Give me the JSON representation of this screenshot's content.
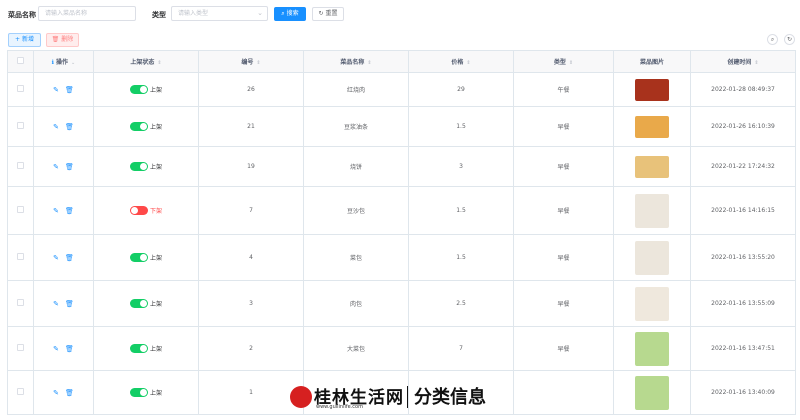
{
  "search": {
    "name_label": "菜品名称",
    "name_placeholder": "请输入菜品名称",
    "type_label": "类型",
    "type_placeholder": "请输入类型",
    "search_button": "搜索",
    "reset_button": "重置"
  },
  "toolbar": {
    "add_button": "新增",
    "delete_button": "删除"
  },
  "table": {
    "headers": {
      "ops": "操作",
      "status": "上架状态",
      "id": "编号",
      "name": "菜品名称",
      "price": "价格",
      "type": "类型",
      "image": "菜品图片",
      "created": "创建时间"
    },
    "rows": [
      {
        "status": "上架",
        "on": true,
        "id": "26",
        "name": "红烧肉",
        "price": "29",
        "type": "午餐",
        "created": "2022-01-28 08:49:37",
        "img_color": "#a8321c"
      },
      {
        "status": "上架",
        "on": true,
        "id": "21",
        "name": "豆浆油条",
        "price": "1.5",
        "type": "早餐",
        "created": "2022-01-26 16:10:39",
        "img_color": "#e9a94a"
      },
      {
        "status": "上架",
        "on": true,
        "id": "19",
        "name": "烧饼",
        "price": "3",
        "type": "早餐",
        "created": "2022-01-22 17:24:32",
        "img_color": "#e8c27a"
      },
      {
        "status": "下架",
        "on": false,
        "id": "7",
        "name": "豆沙包",
        "price": "1.5",
        "type": "早餐",
        "created": "2022-01-16 14:16:15",
        "img_color": "#ece6dc"
      },
      {
        "status": "上架",
        "on": true,
        "id": "4",
        "name": "菜包",
        "price": "1.5",
        "type": "早餐",
        "created": "2022-01-16 13:55:20",
        "img_color": "#ece6dc"
      },
      {
        "status": "上架",
        "on": true,
        "id": "3",
        "name": "肉包",
        "price": "2.5",
        "type": "早餐",
        "created": "2022-01-16 13:55:09",
        "img_color": "#efe8dd"
      },
      {
        "status": "上架",
        "on": true,
        "id": "2",
        "name": "大菜包",
        "price": "7",
        "type": "早餐",
        "created": "2022-01-16 13:47:51",
        "img_color": "#b7d98f"
      },
      {
        "status": "上架",
        "on": true,
        "id": "1",
        "name": "",
        "price": "",
        "type": "",
        "created": "2022-01-16 13:40:09",
        "img_color": "#b7d98f"
      }
    ]
  },
  "watermark": {
    "title": "桂林生活网",
    "url": "www.guilinlife.com",
    "category": "分类信息"
  }
}
